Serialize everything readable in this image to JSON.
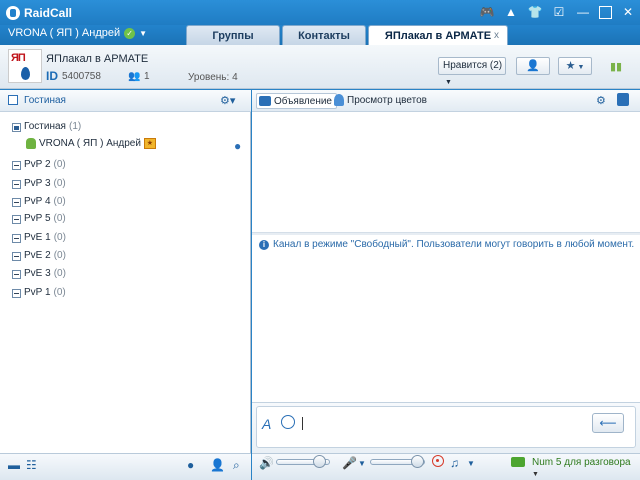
{
  "app": {
    "title": "RaidCall"
  },
  "titlebar": {
    "icons": [
      "gamepad-icon",
      "bell-icon",
      "shirt-icon",
      "checklist-icon",
      "minimize-icon",
      "maximize-icon",
      "close-icon"
    ]
  },
  "user": {
    "name": "VRONA ( ЯП ) Андрей"
  },
  "tabs": [
    {
      "label": "Группы"
    },
    {
      "label": "Контакты"
    },
    {
      "label": "ЯПлакал в АРМАТЕ",
      "active": true,
      "close": "x"
    }
  ],
  "channel": {
    "avatar_text": "ЯП",
    "name": "ЯПлакал в АРМАТЕ",
    "id_label": "ID",
    "id": "5400758",
    "users": "1",
    "level": "Уровень: 4",
    "like_button": "Нравится (2)"
  },
  "left": {
    "header_title": "Гостиная",
    "tree": [
      {
        "label": "Гостиная",
        "count": "(1)",
        "kind": "lobby"
      },
      {
        "label": "PvP 2",
        "count": "(0)"
      },
      {
        "label": "PvP 3",
        "count": "(0)"
      },
      {
        "label": "PvP 4",
        "count": "(0)"
      },
      {
        "label": "PvP 5",
        "count": "(0)"
      },
      {
        "label": "PvE 1",
        "count": "(0)"
      },
      {
        "label": "PvE 2",
        "count": "(0)"
      },
      {
        "label": "PvE 3",
        "count": "(0)"
      },
      {
        "label": "PvP 1",
        "count": "(0)"
      }
    ],
    "member": {
      "name": "VRONA ( ЯП ) Андрей",
      "badge": "VIP"
    }
  },
  "right": {
    "announcement_label": "Объявление",
    "flowers_label": "Просмотр цветов",
    "notice": "Канал в режиме \"Свободный\". Пользователи могут говорить в любой момент.",
    "send_label": "⟵"
  },
  "status": {
    "voice_mode": "Num 5 для разговора",
    "speaker_volume": 0.8,
    "mic_volume": 0.85
  },
  "colors": {
    "brand": "#1f7cc3",
    "accent": "#2a6fb6",
    "voice_mode": "#2e7a1d"
  }
}
